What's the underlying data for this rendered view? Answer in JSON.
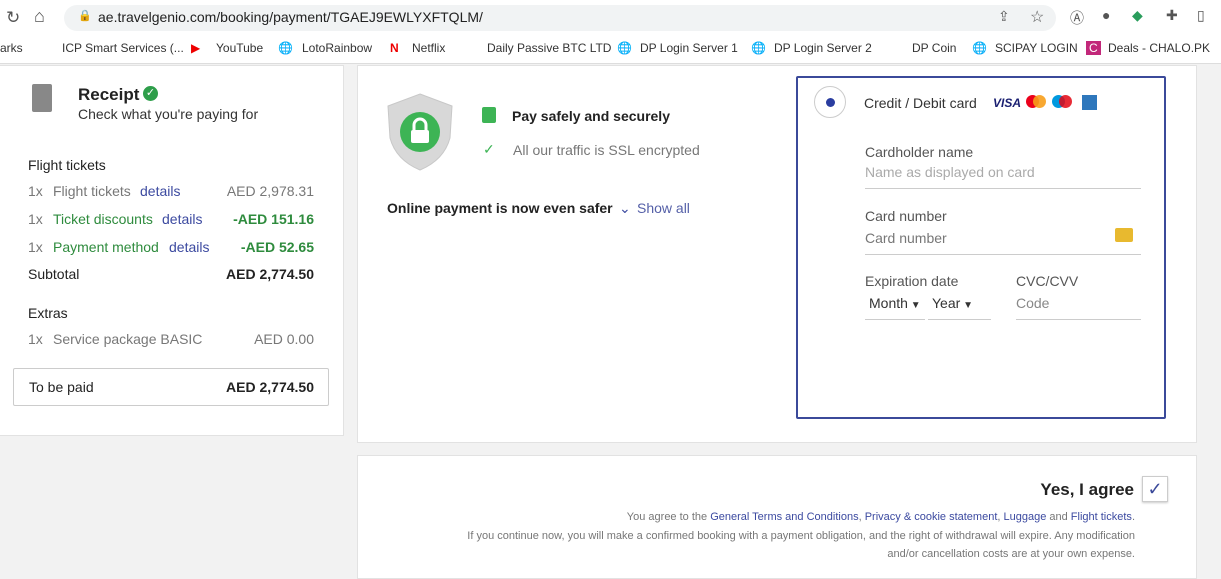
{
  "browser": {
    "url": "ae.travelgenio.com/booking/payment/TGAEJ9EWLYXFTQLM/",
    "bookmarks": [
      "arks",
      "ICP Smart Services (...",
      "YouTube",
      "LotoRainbow",
      "Netflix",
      "Daily Passive BTC LTD",
      "DP Login Server 1",
      "DP Login  Server 2",
      "DP Coin",
      "SCIPAY LOGIN",
      "Deals - CHALO.PK"
    ]
  },
  "receipt": {
    "title": "Receipt",
    "subtitle": "Check what you're paying for",
    "flight_heading": "Flight tickets",
    "items": [
      {
        "qty": "1x",
        "label": "Flight tickets",
        "link": "details",
        "amount": "AED 2,978.31"
      },
      {
        "qty": "1x",
        "label": "Ticket discounts",
        "link": "details",
        "amount": "-AED 151.16"
      },
      {
        "qty": "1x",
        "label": "Payment method",
        "link": "details",
        "amount": "-AED 52.65"
      }
    ],
    "subtotal_label": "Subtotal",
    "subtotal": "AED 2,774.50",
    "extras_heading": "Extras",
    "extra": {
      "qty": "1x",
      "label": "Service package BASIC",
      "amount": "AED 0.00"
    },
    "total_label": "To be paid",
    "total": "AED 2,774.50"
  },
  "security": {
    "title": "Pay safely and securely",
    "ssl": "All our traffic is SSL encrypted",
    "online": "Online payment is now even safer",
    "show_all": "Show all"
  },
  "card": {
    "method": "Credit / Debit card",
    "brands": [
      "VISA",
      "Mastercard",
      "Maestro",
      "Amex"
    ],
    "holder_label": "Cardholder name",
    "holder_placeholder": "Name as displayed on card",
    "number_label": "Card number",
    "number_placeholder": "Card number",
    "exp_label": "Expiration date",
    "month": "Month",
    "year": "Year",
    "cvc_label": "CVC/CVV",
    "cvc_placeholder": "Code"
  },
  "agree": {
    "label": "Yes, I agree",
    "checked": true,
    "line1_pre": "You agree to the ",
    "terms": "General Terms and Conditions",
    "comma": ", ",
    "privacy": "Privacy & cookie statement",
    "comma2": ", ",
    "luggage": "Luggage",
    "and": " and ",
    "flight": "Flight tickets",
    ".": ".",
    "line2": "If you continue now, you will make a confirmed booking with a payment obligation, and the right of withdrawal will expire. Any modification",
    "line3": "and/or cancellation costs are at your own expense."
  }
}
